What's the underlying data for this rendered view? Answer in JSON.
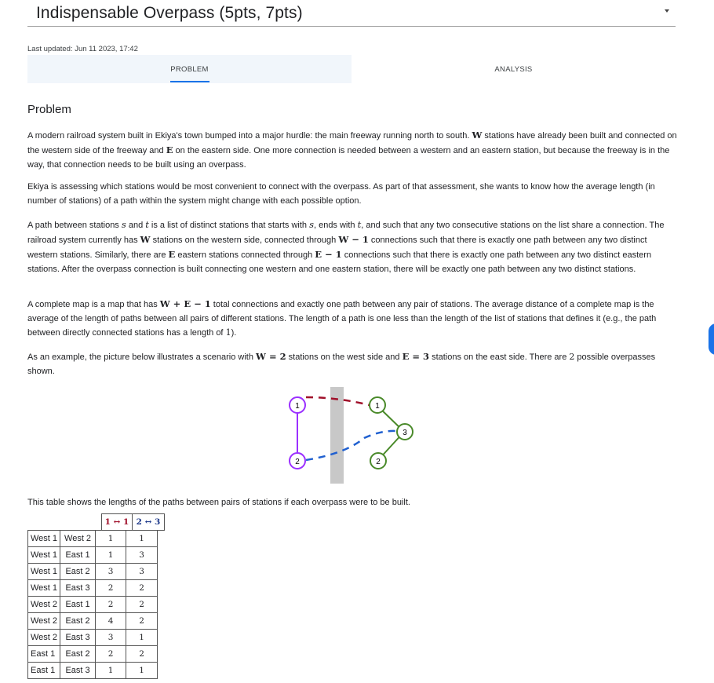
{
  "header": {
    "title": "Indispensable Overpass (5pts, 7pts)",
    "last_updated": "Last updated: Jun 11 2023, 17:42"
  },
  "tabs": [
    {
      "label": "PROBLEM",
      "active": true
    },
    {
      "label": "ANALYSIS",
      "active": false
    }
  ],
  "content": {
    "heading": "Problem",
    "p1": {
      "s1": "A modern railroad system built in Ekiya's town bumped into a major hurdle: the main freeway running north to south. ",
      "W": "W",
      "s2": " stations have already been built and connected on the western side of the freeway and ",
      "E": "E",
      "s3": " on the eastern side. One more connection is needed between a western and an eastern station, but because the freeway is in the way, that connection needs to be built using an overpass."
    },
    "p2": "Ekiya is assessing which stations would be most convenient to connect with the overpass. As part of that assessment, she wants to know how the average length (in number of stations) of a path within the system might change with each possible option.",
    "p3": {
      "s1": "A path between stations ",
      "s": "s",
      "s2": " and ",
      "t": "t",
      "s3": " is a list of distinct stations that starts with ",
      "s4": ", ends with ",
      "s5": ", and such that any two consecutive stations on the list share a connection. The railroad system currently has ",
      "W": "W",
      "s6": " stations on the western side, connected through ",
      "Wm1": "W − 1",
      "s7": " connections such that there is exactly one path between any two distinct western stations. Similarly, there are ",
      "E": "E",
      "s8": " eastern stations connected through ",
      "Em1": "E − 1",
      "s9": " connections such that there is exactly one path between any two distinct eastern stations. After the overpass connection is built connecting one western and one eastern station, there will be exactly one path between any two distinct stations."
    },
    "p4": {
      "s1": "A complete map is a map that has ",
      "WE": "W + E − 1",
      "s2": " total connections and exactly one path between any pair of stations. The average distance of a complete map is the average of the length of paths between all pairs of different stations. The length of a path is one less than the length of the list of stations that defines it (e.g., the path between directly connected stations has a length of ",
      "one": "1",
      "s3": ")."
    },
    "p5": {
      "s1": "As an example, the picture below illustrates a scenario with ",
      "W2": "W = 2",
      "s2": " stations on the west side and ",
      "E3": "E = 3",
      "s3": " stations on the east side. There are ",
      "two": "2",
      "s4": " possible overpasses shown."
    },
    "table_caption": "This table shows the lengths of the paths between pairs of stations if each overpass were to be built."
  },
  "figure": {
    "west_nodes": [
      "1",
      "2"
    ],
    "east_nodes": [
      "1",
      "2",
      "3"
    ],
    "colors": {
      "west": "#9b30ff",
      "east": "#4a8a2a",
      "overpass_1_1": "#a0102a",
      "overpass_2_3": "#2060d0",
      "freeway": "#c8c8c8"
    }
  },
  "path_table": {
    "overpass_headers": [
      "1 ↔ 1",
      "2 ↔ 3"
    ],
    "rows": [
      {
        "a": "West 1",
        "b": "West 2",
        "v1": "1",
        "v2": "1"
      },
      {
        "a": "West 1",
        "b": "East 1",
        "v1": "1",
        "v2": "3"
      },
      {
        "a": "West 1",
        "b": "East 2",
        "v1": "3",
        "v2": "3"
      },
      {
        "a": "West 1",
        "b": "East 3",
        "v1": "2",
        "v2": "2"
      },
      {
        "a": "West 2",
        "b": "East 1",
        "v1": "2",
        "v2": "2"
      },
      {
        "a": "West 2",
        "b": "East 2",
        "v1": "4",
        "v2": "2"
      },
      {
        "a": "West 2",
        "b": "East 3",
        "v1": "3",
        "v2": "1"
      },
      {
        "a": "East 1",
        "b": "East 2",
        "v1": "2",
        "v2": "2"
      },
      {
        "a": "East 1",
        "b": "East 3",
        "v1": "1",
        "v2": "1"
      }
    ]
  }
}
